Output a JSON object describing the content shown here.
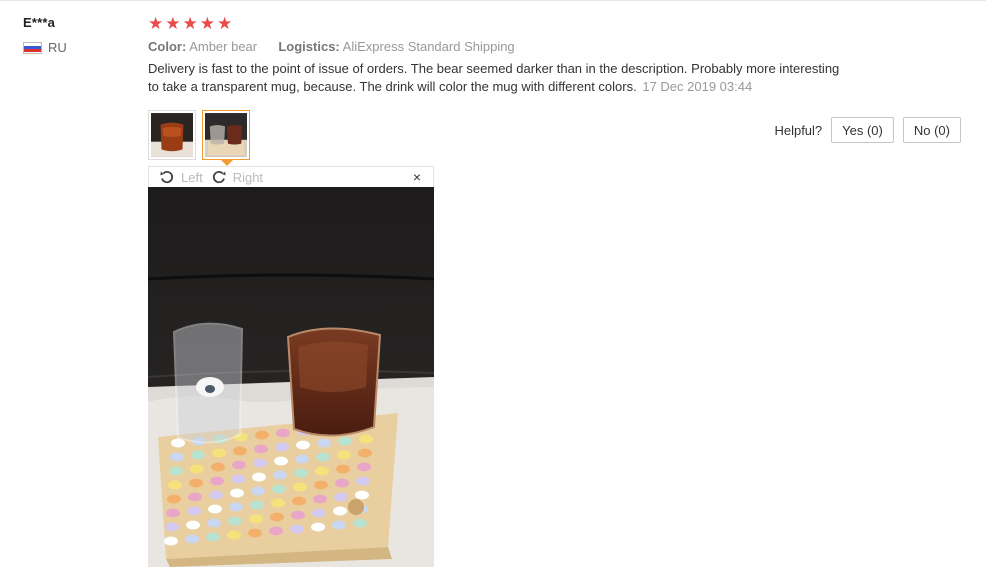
{
  "review": {
    "user_name": "E***a",
    "country_code": "RU",
    "rating_stars": 5,
    "color_label": "Color:",
    "color_value": "Amber bear",
    "logistics_label": "Logistics:",
    "logistics_value": "AliExpress Standard Shipping",
    "text": "Delivery is fast to the point of issue of orders. The bear seemed darker than in the description. Probably more interesting to take a transparent mug, because. The drink will color the mug with different colors.",
    "date": "17 Dec 2019 03:44"
  },
  "helpful": {
    "label": "Helpful?",
    "yes_label": "Yes (0)",
    "no_label": "No (0)"
  },
  "viewer": {
    "rotate_left_label": "Left",
    "rotate_right_label": "Right",
    "close_glyph": "×"
  },
  "colors": {
    "star": "#e94b4b",
    "active_thumb_border": "#f29b30"
  },
  "icons": [
    "star-icon",
    "flag-ru-icon",
    "rotate-left-icon",
    "rotate-right-icon",
    "close-icon"
  ]
}
